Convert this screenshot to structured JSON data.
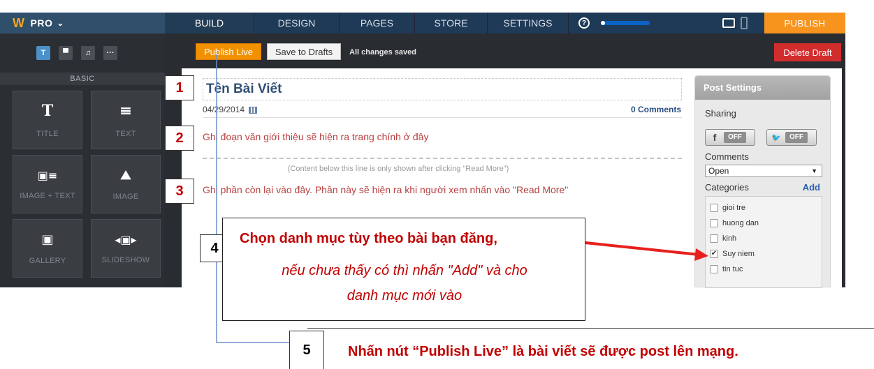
{
  "topbar": {
    "brand": "PRO",
    "brand_caret": "⌄",
    "logo": "W",
    "tabs": [
      {
        "label": "BUILD",
        "active": true
      },
      {
        "label": "DESIGN",
        "active": false
      },
      {
        "label": "PAGES",
        "active": false
      },
      {
        "label": "STORE",
        "active": false
      },
      {
        "label": "SETTINGS",
        "active": false
      }
    ],
    "help": "?",
    "publish": "PUBLISH"
  },
  "sidebar": {
    "tab_icons": [
      "T",
      "▀",
      "♫",
      "···"
    ],
    "section_label": "BASIC",
    "tiles": [
      {
        "icon": "T",
        "label": "TITLE"
      },
      {
        "icon": "≡",
        "label": "TEXT"
      },
      {
        "icon": "▣≡",
        "label": "IMAGE + TEXT"
      },
      {
        "icon": "⛰",
        "label": "IMAGE"
      },
      {
        "icon": "▣",
        "label": "GALLERY"
      },
      {
        "icon": "◂▣▸",
        "label": "SLIDESHOW"
      }
    ]
  },
  "toolbar": {
    "publish_live": "Publish Live",
    "save_drafts": "Save to Drafts",
    "status": "All changes saved",
    "delete_draft": "Delete Draft"
  },
  "post": {
    "title": "Tên Bài Viết",
    "date": "04/29/2014",
    "comments": "0 Comments",
    "intro": "Ghi đoạn văn giới thiệu sẽ hiện ra trang chính ở đây",
    "readmore_note": "(Content below this line is only shown after clicking \"Read More\")",
    "rest": "Ghi phần còn lại vào đây.  Phần này sẽ hiện ra khi người xem nhấn vào \"Read More\""
  },
  "settings": {
    "header": "Post Settings",
    "sharing_label": "Sharing",
    "facebook": {
      "icon": "f",
      "state": "OFF"
    },
    "twitter": {
      "icon": "🐦",
      "state": "OFF"
    },
    "comments_label": "Comments",
    "comments_value": "Open",
    "categories_label": "Categories",
    "add": "Add",
    "categories": [
      {
        "name": "gioi tre",
        "checked": false
      },
      {
        "name": "huong dan",
        "checked": false
      },
      {
        "name": "kinh",
        "checked": false
      },
      {
        "name": "Suy niem",
        "checked": true
      },
      {
        "name": "tin tuc",
        "checked": false
      }
    ]
  },
  "annotations": {
    "n1": "1",
    "n2": "2",
    "n3": "3",
    "n4": "4",
    "n5": "5",
    "callout4_line1": "Chọn danh mục tùy theo bài bạn đăng,",
    "callout4_line2": "nếu chưa thấy có thì nhấn \"Add\" và cho",
    "callout4_line3": "danh mục mới vào",
    "callout5": "Nhấn nút “Publish Live” là bài viết sẽ được post lên mạng.",
    "arrow_color": "#e8201c",
    "connector_color": "#6f8fc9"
  }
}
